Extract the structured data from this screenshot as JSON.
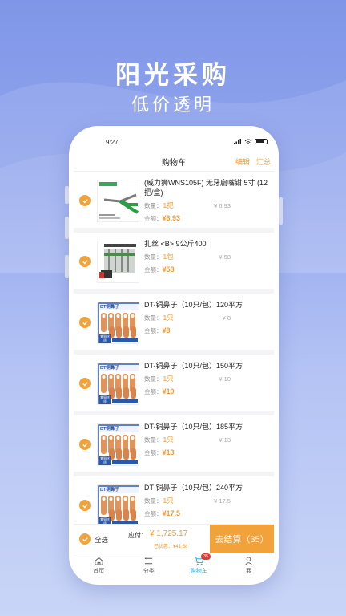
{
  "promo": {
    "title": "阳光采购",
    "subtitle": "低价透明"
  },
  "status_bar": {
    "time": "9:27"
  },
  "nav": {
    "title": "购物车",
    "edit": "编辑",
    "summary": "汇总"
  },
  "labels": {
    "qty": "数量：",
    "amount": "金额："
  },
  "items": [
    {
      "name": "(威力狮WNS105F) 无牙扁嘴钳 5寸 (12把/盒)",
      "qty": "1把",
      "unit_price": "¥ 6.93",
      "amount": "¥6.93",
      "thumb_type": "pliers"
    },
    {
      "name": "扎丝 <B> 9公斤400",
      "qty": "1包",
      "unit_price": "¥ 58",
      "amount": "¥58",
      "thumb_type": "wire"
    },
    {
      "name": "DT-铜鼻子（10只/包）120平方",
      "qty": "1只",
      "unit_price": "¥ 8",
      "amount": "¥8",
      "thumb_type": "lug"
    },
    {
      "name": "DT-铜鼻子（10只/包）150平方",
      "qty": "1只",
      "unit_price": "¥ 10",
      "amount": "¥10",
      "thumb_type": "lug"
    },
    {
      "name": "DT-铜鼻子（10只/包）185平方",
      "qty": "1只",
      "unit_price": "¥ 13",
      "amount": "¥13",
      "thumb_type": "lug"
    },
    {
      "name": "DT-铜鼻子（10只/包）240平方",
      "qty": "1只",
      "unit_price": "¥ 17.5",
      "amount": "¥17.5",
      "thumb_type": "lug"
    }
  ],
  "thumb_text": {
    "lug_title": "DT铜鼻子",
    "lug_tag": "紫铜材质"
  },
  "checkout": {
    "select_all": "全选",
    "payable_label": "应付：",
    "payable_value": "¥ 1,725.17",
    "discount": "已优惠：¥41.58",
    "pay_button": "去结算（35）"
  },
  "tabbar": {
    "tabs": [
      {
        "label": "首页",
        "icon": "home-icon"
      },
      {
        "label": "分类",
        "icon": "list-icon"
      },
      {
        "label": "购物车",
        "icon": "cart-icon",
        "active": true
      },
      {
        "label": "我",
        "icon": "user-icon"
      }
    ],
    "cart_badge": "35"
  },
  "colors": {
    "accent": "#f2a23a",
    "active_tab": "#2fa8e0",
    "background": "#8fa3ec"
  }
}
